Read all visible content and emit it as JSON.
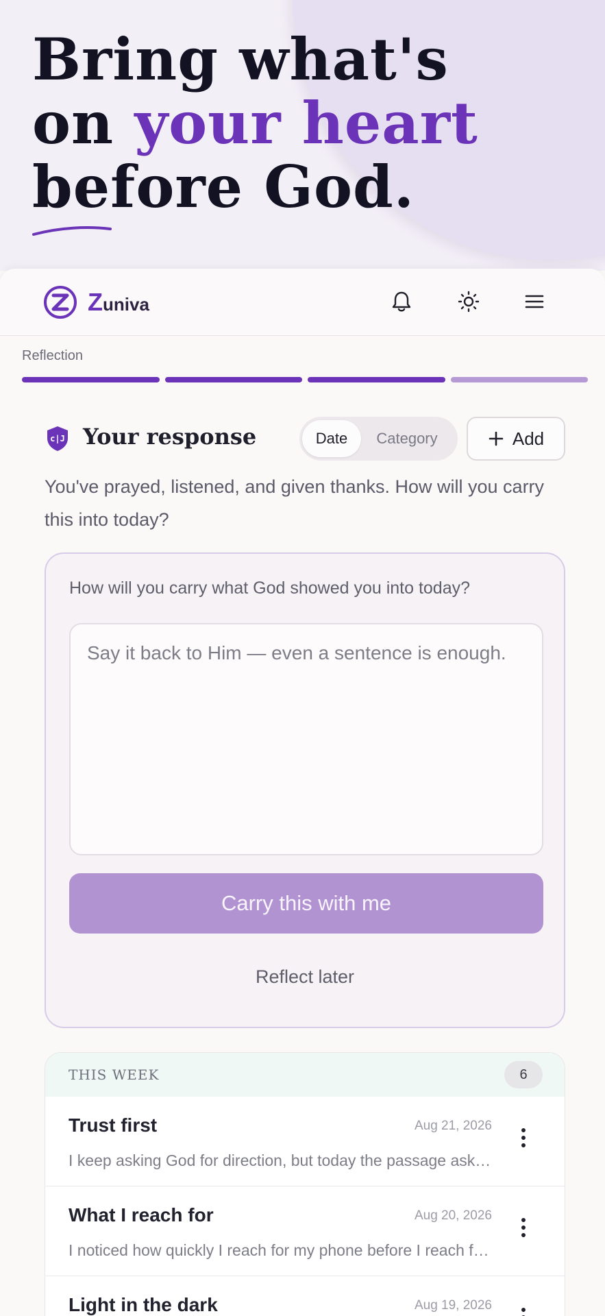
{
  "hero": {
    "line1": "Bring what's",
    "line2_prefix": "on ",
    "line2_accent": "your heart",
    "line3": "before God."
  },
  "brand": {
    "initial": "Z",
    "name_rest": "univa"
  },
  "nav": {
    "icons": [
      "bell-icon",
      "sun-icon",
      "menu-icon"
    ]
  },
  "progress": {
    "label": "Reflection",
    "steps_total": 4,
    "steps_complete": 3
  },
  "response": {
    "title": "Your response",
    "toggle": {
      "date": "Date",
      "category": "Category",
      "selected": "Date"
    },
    "add_label": "Add",
    "intro": "You've prayed, listened, and given thanks. How will you carry this into today?"
  },
  "card": {
    "question": "How will you carry what God showed you into today?",
    "placeholder": "Say it back to Him — even a sentence is enough.",
    "value": "",
    "primary_button": "Carry this with me",
    "secondary_button": "Reflect later"
  },
  "list": {
    "header": "THIS WEEK",
    "count": "6",
    "entries": [
      {
        "title": "Trust first",
        "date": "Aug 21, 2026",
        "snippet": "I keep asking God for direction, but today the passage asked me to trust first and see later."
      },
      {
        "title": "What I reach for",
        "date": "Aug 20, 2026",
        "snippet": "I noticed how quickly I reach for my phone before I reach for prayer in the morning."
      },
      {
        "title": "Light in the dark",
        "date": "Aug 19, 2026",
        "snippet": ""
      }
    ]
  },
  "colors": {
    "accent": "#6a33b8",
    "accent_soft": "#b293d2",
    "text": "#1f1f29"
  }
}
